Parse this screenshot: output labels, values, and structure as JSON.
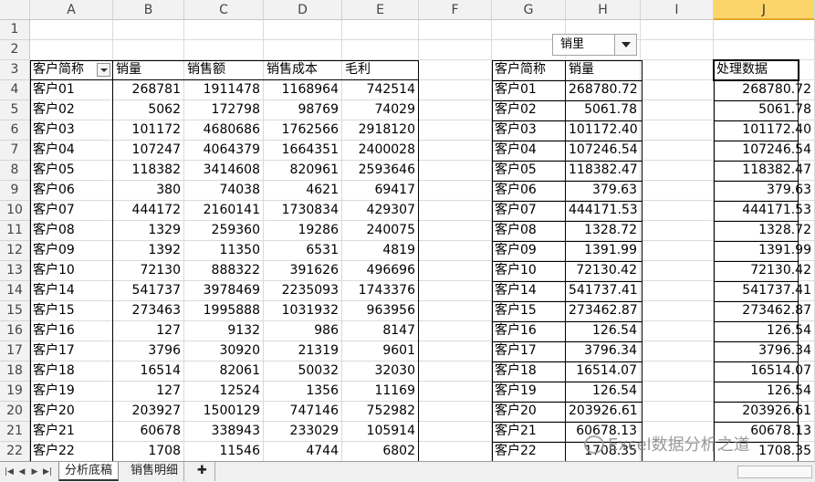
{
  "columns": [
    "A",
    "B",
    "C",
    "D",
    "E",
    "F",
    "G",
    "H",
    "I",
    "J"
  ],
  "selected_column": "J",
  "rows": [
    "1",
    "2",
    "3",
    "4",
    "5",
    "6",
    "7",
    "8",
    "9",
    "10",
    "11",
    "12",
    "13",
    "14",
    "15",
    "16",
    "17",
    "18",
    "19",
    "20",
    "21",
    "22"
  ],
  "dropdown": {
    "value": "销里"
  },
  "table1": {
    "headers": [
      "客户简称",
      "销量",
      "销售额",
      "销售成本",
      "毛利"
    ],
    "rows": [
      [
        "客户01",
        "268781",
        "1911478",
        "1168964",
        "742514"
      ],
      [
        "客户02",
        "5062",
        "172798",
        "98769",
        "74029"
      ],
      [
        "客户03",
        "101172",
        "4680686",
        "1762566",
        "2918120"
      ],
      [
        "客户04",
        "107247",
        "4064379",
        "1664351",
        "2400028"
      ],
      [
        "客户05",
        "118382",
        "3414608",
        "820961",
        "2593646"
      ],
      [
        "客户06",
        "380",
        "74038",
        "4621",
        "69417"
      ],
      [
        "客户07",
        "444172",
        "2160141",
        "1730834",
        "429307"
      ],
      [
        "客户08",
        "1329",
        "259360",
        "19286",
        "240075"
      ],
      [
        "客户09",
        "1392",
        "11350",
        "6531",
        "4819"
      ],
      [
        "客户10",
        "72130",
        "888322",
        "391626",
        "496696"
      ],
      [
        "客户14",
        "541737",
        "3978469",
        "2235093",
        "1743376"
      ],
      [
        "客户15",
        "273463",
        "1995888",
        "1031932",
        "963956"
      ],
      [
        "客户16",
        "127",
        "9132",
        "986",
        "8147"
      ],
      [
        "客户17",
        "3796",
        "30920",
        "21319",
        "9601"
      ],
      [
        "客户18",
        "16514",
        "82061",
        "50032",
        "32030"
      ],
      [
        "客户19",
        "127",
        "12524",
        "1356",
        "11169"
      ],
      [
        "客户20",
        "203927",
        "1500129",
        "747146",
        "752982"
      ],
      [
        "客户21",
        "60678",
        "338943",
        "233029",
        "105914"
      ],
      [
        "客户22",
        "1708",
        "11546",
        "4744",
        "6802"
      ]
    ]
  },
  "table2": {
    "headers": [
      "客户简称",
      "销量"
    ],
    "rows": [
      [
        "客户01",
        "268780.72"
      ],
      [
        "客户02",
        "5061.78"
      ],
      [
        "客户03",
        "101172.40"
      ],
      [
        "客户04",
        "107246.54"
      ],
      [
        "客户05",
        "118382.47"
      ],
      [
        "客户06",
        "379.63"
      ],
      [
        "客户07",
        "444171.53"
      ],
      [
        "客户08",
        "1328.72"
      ],
      [
        "客户09",
        "1391.99"
      ],
      [
        "客户10",
        "72130.42"
      ],
      [
        "客户14",
        "541737.41"
      ],
      [
        "客户15",
        "273462.87"
      ],
      [
        "客户16",
        "126.54"
      ],
      [
        "客户17",
        "3796.34"
      ],
      [
        "客户18",
        "16514.07"
      ],
      [
        "客户19",
        "126.54"
      ],
      [
        "客户20",
        "203926.61"
      ],
      [
        "客户21",
        "60678.13"
      ],
      [
        "客户22",
        "1708.35"
      ]
    ]
  },
  "table3": {
    "header": "处理数据",
    "rows": [
      "268780.72",
      "5061.78",
      "101172.40",
      "107246.54",
      "118382.47",
      "379.63",
      "444171.53",
      "1328.72",
      "1391.99",
      "72130.42",
      "541737.41",
      "273462.87",
      "126.54",
      "3796.34",
      "16514.07",
      "126.54",
      "203926.61",
      "60678.13",
      "1708.35"
    ]
  },
  "sheet_tabs": [
    {
      "label": "分析底稿",
      "active": true
    },
    {
      "label": "销售明细",
      "active": false
    }
  ],
  "watermark": "Excel数据分析之道"
}
